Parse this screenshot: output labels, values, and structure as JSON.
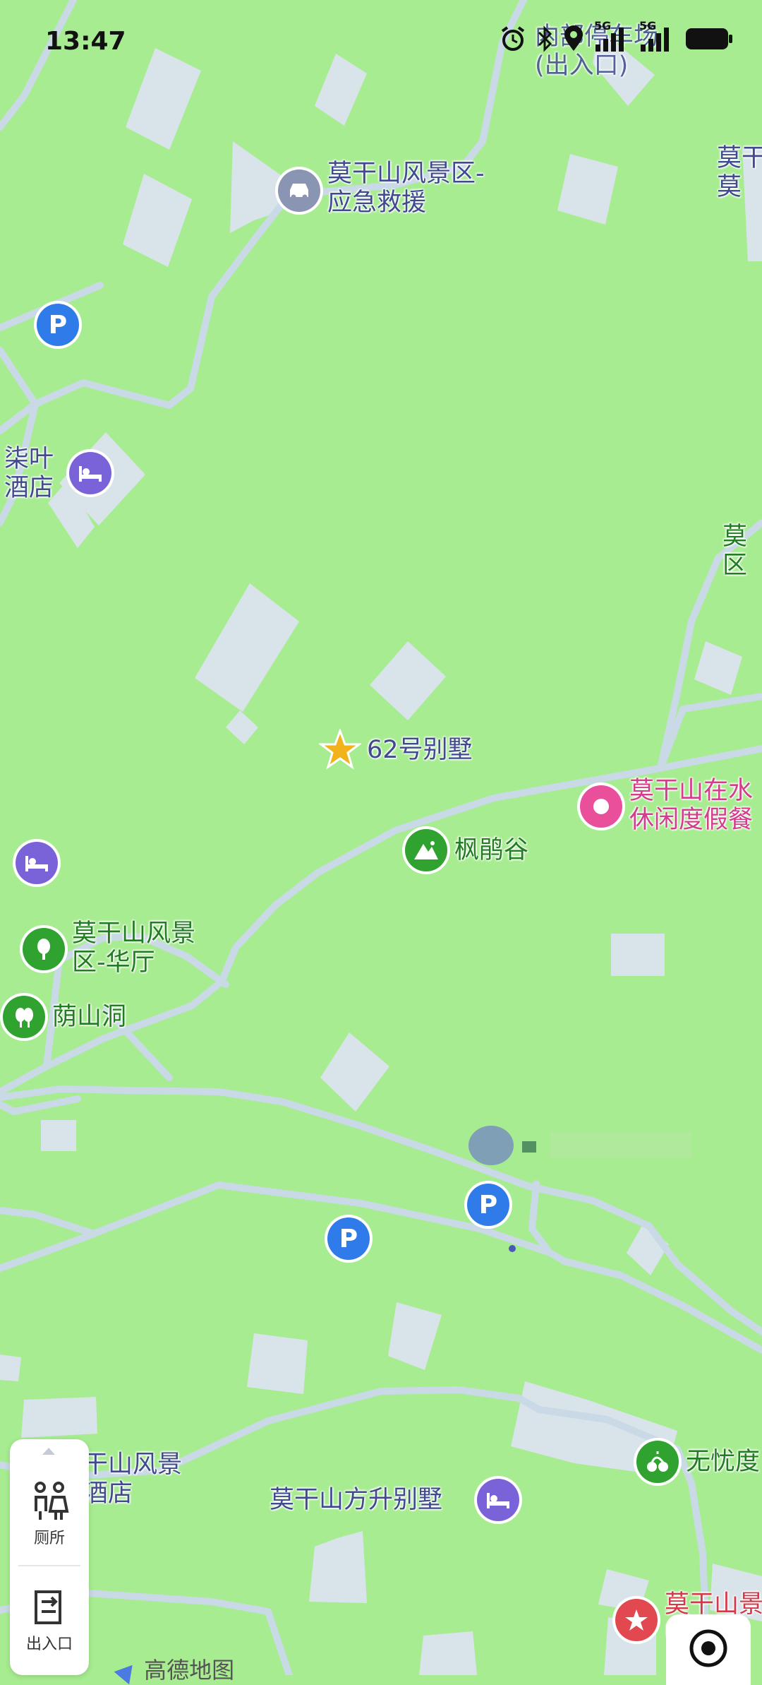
{
  "status_bar": {
    "time": "13:47",
    "network": "5G",
    "icons": [
      "alarm-icon",
      "bluetooth-icon",
      "location-icon",
      "signal-icon",
      "battery-icon"
    ]
  },
  "map": {
    "labels": [
      {
        "id": "parking-lot-top",
        "text": "内部停车场\n(出入口)"
      },
      {
        "id": "emergency",
        "text": "莫干山风景区-\n应急救援"
      },
      {
        "id": "right-top",
        "text": "莫干\n莫"
      },
      {
        "id": "qiye-hotel",
        "text": "柒叶\n酒店"
      },
      {
        "id": "right-mid",
        "text": "莫\n区"
      },
      {
        "id": "villa-62",
        "text": "62号别墅"
      },
      {
        "id": "zaishui",
        "text": "莫干山在水\n休闲度假餐"
      },
      {
        "id": "fengjuegu",
        "text": "枫鹃谷"
      },
      {
        "id": "huating",
        "text": "莫干山风景\n区-华厅"
      },
      {
        "id": "yinshandong",
        "text": "荫山洞"
      },
      {
        "id": "left-bottom",
        "text": "干山风景\n酒店"
      },
      {
        "id": "fangsheng",
        "text": "莫干山方升别墅"
      },
      {
        "id": "wuyou",
        "text": "无忧度"
      },
      {
        "id": "right-bottom",
        "text": "莫干山景\n中"
      }
    ],
    "watermark": "高德地图",
    "colors": {
      "land": "#a8ec91",
      "road": "#c9d9e6",
      "building": "#d9e3ea",
      "parking": "#2f7bea",
      "hotel": "#7a63d9",
      "scenic": "#2fa22f",
      "pink": "#e94f9b",
      "star": "#f2b21b",
      "gray_poi": "#8a94b3"
    }
  },
  "side_panel": {
    "toilet_label": "厕所",
    "entrance_label": "出入口"
  }
}
